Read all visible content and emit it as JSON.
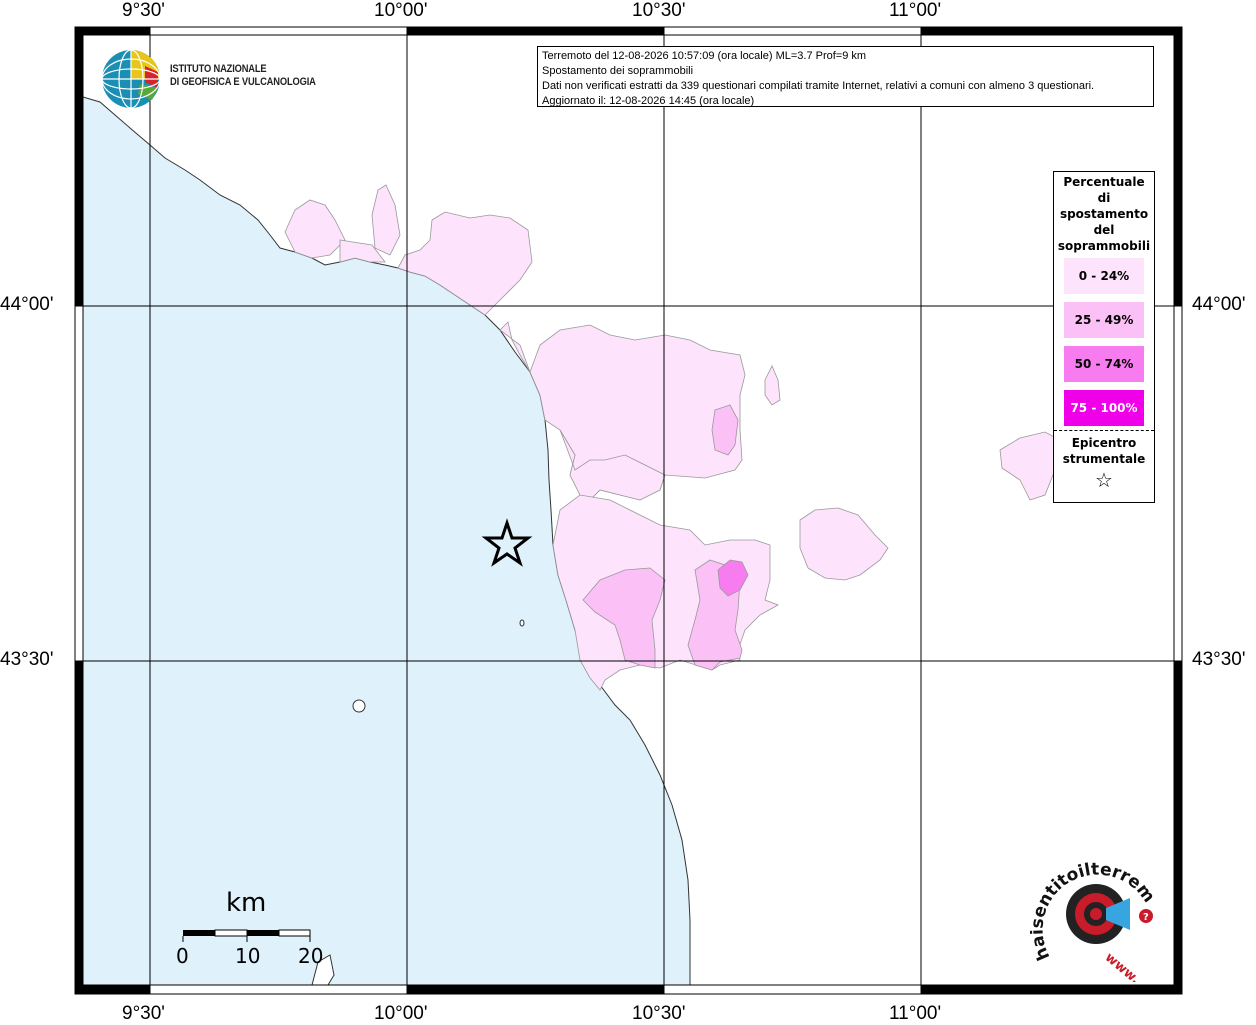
{
  "map": {
    "longitude_ticks": [
      "9°30'",
      "10°00'",
      "10°30'",
      "11°00'"
    ],
    "latitude_ticks": [
      "44°00'",
      "43°30'"
    ]
  },
  "info": {
    "line1": "Terremoto del 12-08-2026 10:57:09 (ora locale) ML=3.7 Prof=9 km",
    "line2": "Spostamento dei soprammobili",
    "line3": "Dati non verificati estratti da 339 questionari compilati tramite Internet, relativi a comuni con almeno 3 questionari.",
    "line4": "Aggiornato il: 12-08-2026 14:45 (ora locale)"
  },
  "logo": {
    "line1": "ISTITUTO NAZIONALE",
    "line2": "DI GEOFISICA E VULCANOLOGIA"
  },
  "legend": {
    "title_lines": [
      "Percentuale",
      "di",
      "spostamento",
      "del",
      "soprammobili"
    ],
    "items": [
      {
        "label": "0 - 24%",
        "color": "#fde3fb"
      },
      {
        "label": "25 - 49%",
        "color": "#fbc1f7"
      },
      {
        "label": "50 - 74%",
        "color": "#f77cef"
      },
      {
        "label": "75 - 100%",
        "color": "#f000e8"
      }
    ],
    "epicenter_lines": [
      "Epicentro",
      "strumentale"
    ]
  },
  "scale": {
    "unit": "km",
    "labels": [
      "0",
      "10",
      "20"
    ]
  },
  "watermark": {
    "text": "haisentitoilterremoto.it",
    "url_text": "www."
  },
  "colors": {
    "sea": "#dff1fb",
    "land": "#ffffff",
    "grid": "#000000"
  }
}
